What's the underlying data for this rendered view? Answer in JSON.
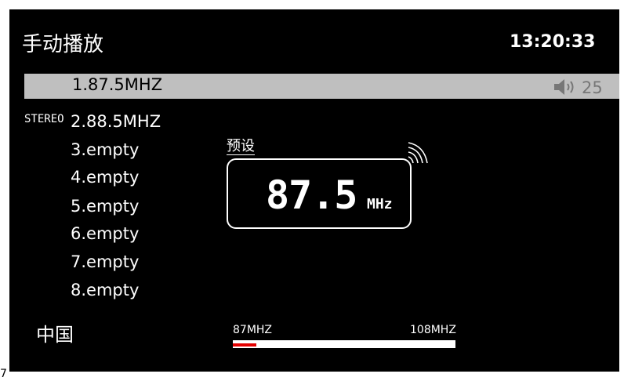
{
  "header": {
    "title": "手动播放",
    "clock": "13:20:33"
  },
  "status": {
    "stereo": "STEREO",
    "volume": "25"
  },
  "channels": [
    {
      "label": "1.87.5MHZ",
      "selected": true
    },
    {
      "label": "2.88.5MHZ",
      "selected": false
    },
    {
      "label": "3.empty",
      "selected": false
    },
    {
      "label": "4.empty",
      "selected": false
    },
    {
      "label": "5.empty",
      "selected": false
    },
    {
      "label": "6.empty",
      "selected": false
    },
    {
      "label": "7.empty",
      "selected": false
    },
    {
      "label": "8.empty",
      "selected": false
    }
  ],
  "tuner": {
    "preset_label": "预设",
    "frequency": "87.5",
    "unit": "MHz"
  },
  "region": "中国",
  "band": {
    "low": "87MHZ",
    "high": "108MHZ",
    "position": 0
  },
  "footer": {
    "corner_mark": "7"
  },
  "colors": {
    "background": "#000000",
    "highlight": "#bfbfbf",
    "band_fill": "#e30000"
  },
  "icons": {
    "volume": "speaker-icon",
    "signal": "signal-icon"
  }
}
